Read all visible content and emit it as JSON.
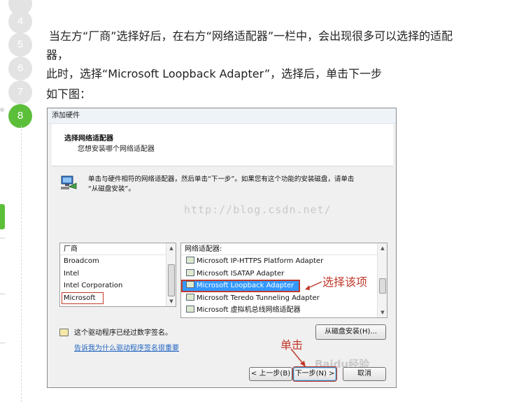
{
  "steps": [
    {
      "num": "4"
    },
    {
      "num": "5"
    },
    {
      "num": "6"
    },
    {
      "num": "7"
    },
    {
      "num": "8"
    }
  ],
  "article": {
    "line1": "当左方“厂商”选择好后，在右方“网络适配器”一栏中，会出现很多可以选择的适配",
    "line2": "器，",
    "line3": "此时，选择“Microsoft Loopback Adapter”，选择后，单击下一步",
    "line4": "如下图："
  },
  "dialog": {
    "window_title": "添加硬件",
    "header_title": "选择网络适配器",
    "header_subtitle": "您想安装哪个网络适配器",
    "info_line1": "单击与硬件相符的网络适配器，然后单击“下一步”。如果您有这个功能的安装磁盘，请单击",
    "info_line2": "“从磁盘安装”。",
    "watermark": "http://blog.csdn.net/",
    "manufacturer_header": "厂商",
    "manufacturers": [
      "Broadcom",
      "Intel",
      "Intel Corporation",
      "Microsoft"
    ],
    "adapter_header": "网络适配器:",
    "adapters": [
      "Microsoft IP-HTTPS Platform Adapter",
      "Microsoft ISATAP Adapter",
      "Microsoft Loopback Adapter",
      "Microsoft Teredo Tunneling Adapter",
      "Microsoft 虚拟机总线网络适配器"
    ],
    "signed_text": "这个驱动程序已经过数字签名。",
    "signed_link": "告诉我为什么驱动程序签名很重要",
    "have_disk_button": "从磁盘安装(H)...",
    "back_button": "< 上一步(B)",
    "next_button": "下一步(N) >",
    "cancel_button": "取消",
    "annotation_select": "选择该项",
    "annotation_click": "单击",
    "logo_watermark": "Baidu经验"
  },
  "colors": {
    "accent_green": "#5cbf3a",
    "annotation_red": "#c0392b",
    "selection_blue": "#3399ff"
  }
}
